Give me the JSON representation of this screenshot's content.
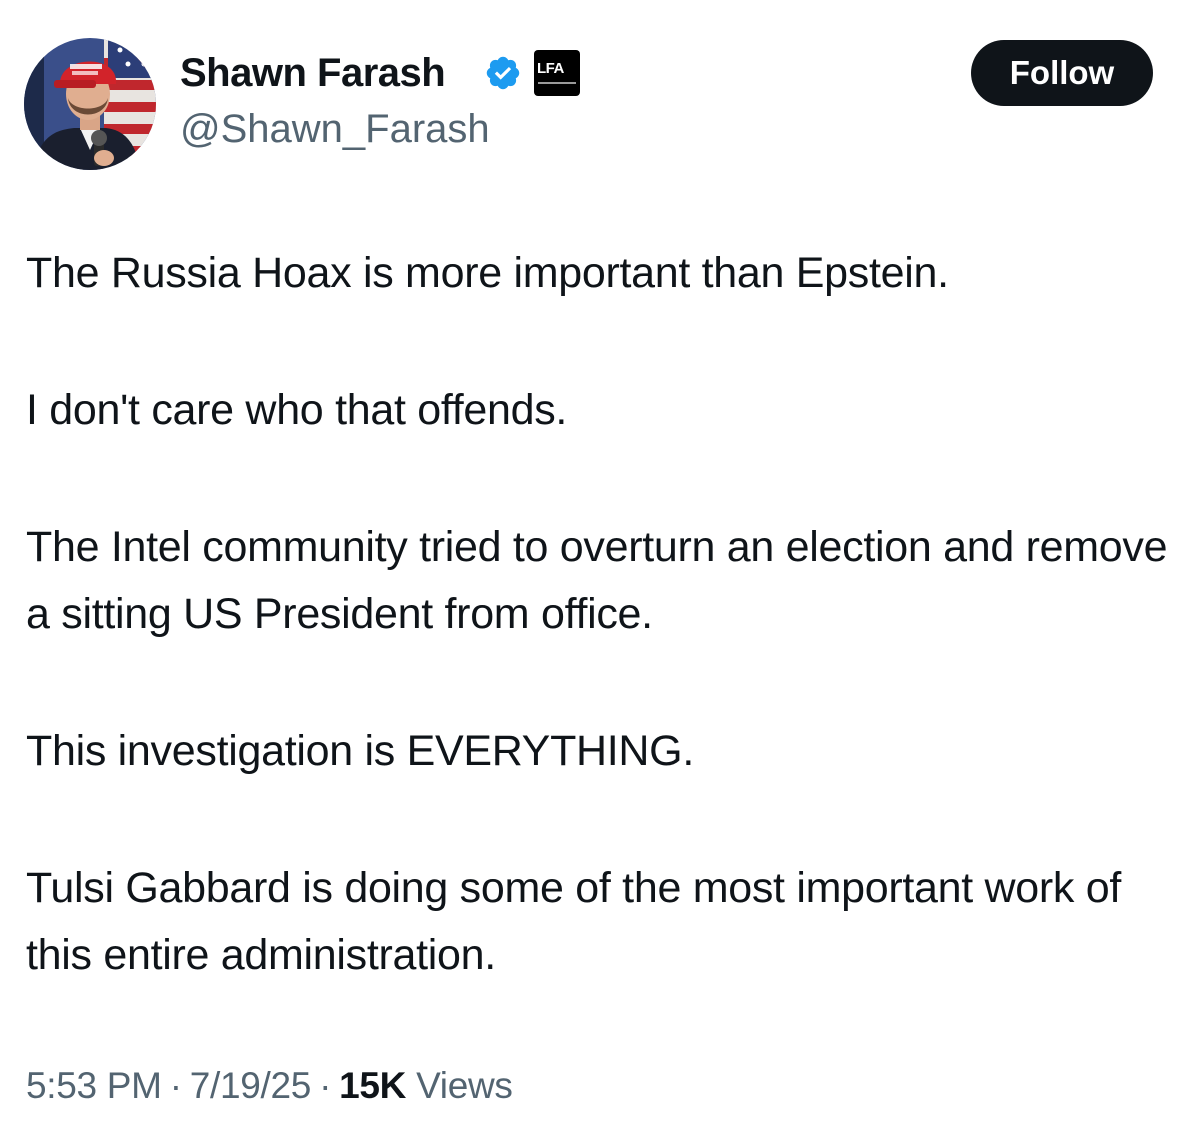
{
  "author": {
    "display_name": "Shawn Farash",
    "handle": "@Shawn_Farash",
    "verified_icon": "verified-badge-icon",
    "affiliate_badge_label": "LFA",
    "brand_blue": "#1d9bf0"
  },
  "follow_button": {
    "label": "Follow",
    "background": "#0f1419",
    "text_color": "#ffffff"
  },
  "tweet": {
    "paragraphs": [
      "The Russia Hoax is more important than Epstein.",
      "I don't care who that offends.",
      "The Intel community tried to overturn an election and remove a sitting US President from office.",
      "This investigation is EVERYTHING.",
      "Tulsi Gabbard is doing some of the most important work of this entire administration."
    ]
  },
  "meta": {
    "time": "5:53 PM",
    "date": "7/19/25",
    "separator": "·",
    "views_count": "15K",
    "views_label": "Views"
  }
}
